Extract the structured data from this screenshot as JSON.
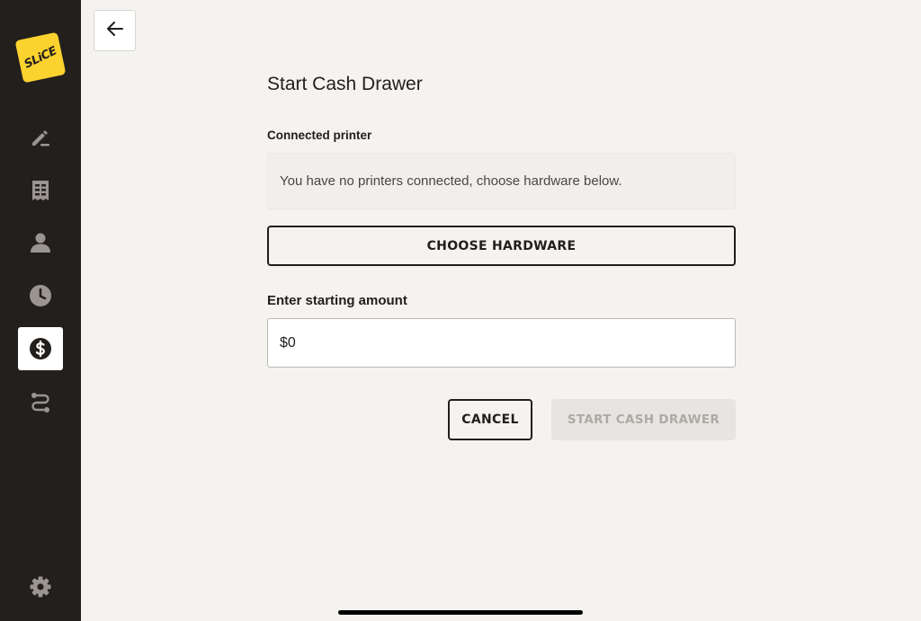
{
  "sidebar": {
    "logo_text": "SLiCE",
    "items": [
      {
        "icon": "edit-icon"
      },
      {
        "icon": "receipt-icon"
      },
      {
        "icon": "customer-icon"
      },
      {
        "icon": "clock-icon"
      },
      {
        "icon": "dollar-icon",
        "active": true
      },
      {
        "icon": "route-icon"
      }
    ],
    "settings_icon": "gear-icon"
  },
  "header": {
    "back_icon": "arrow-left-icon"
  },
  "main": {
    "title": "Start Cash Drawer",
    "printer_label": "Connected printer",
    "printer_message": "You have no printers connected, choose hardware below.",
    "choose_hardware_label": "CHOOSE HARDWARE",
    "amount_label": "Enter starting amount",
    "amount_value": "$0",
    "cancel_label": "CANCEL",
    "start_label": "START CASH DRAWER"
  },
  "colors": {
    "sidebar_bg": "#231f1d",
    "page_bg": "#f4f3f0",
    "logo_yellow": "#fcd22f",
    "disabled_text": "#aeaaa5"
  }
}
